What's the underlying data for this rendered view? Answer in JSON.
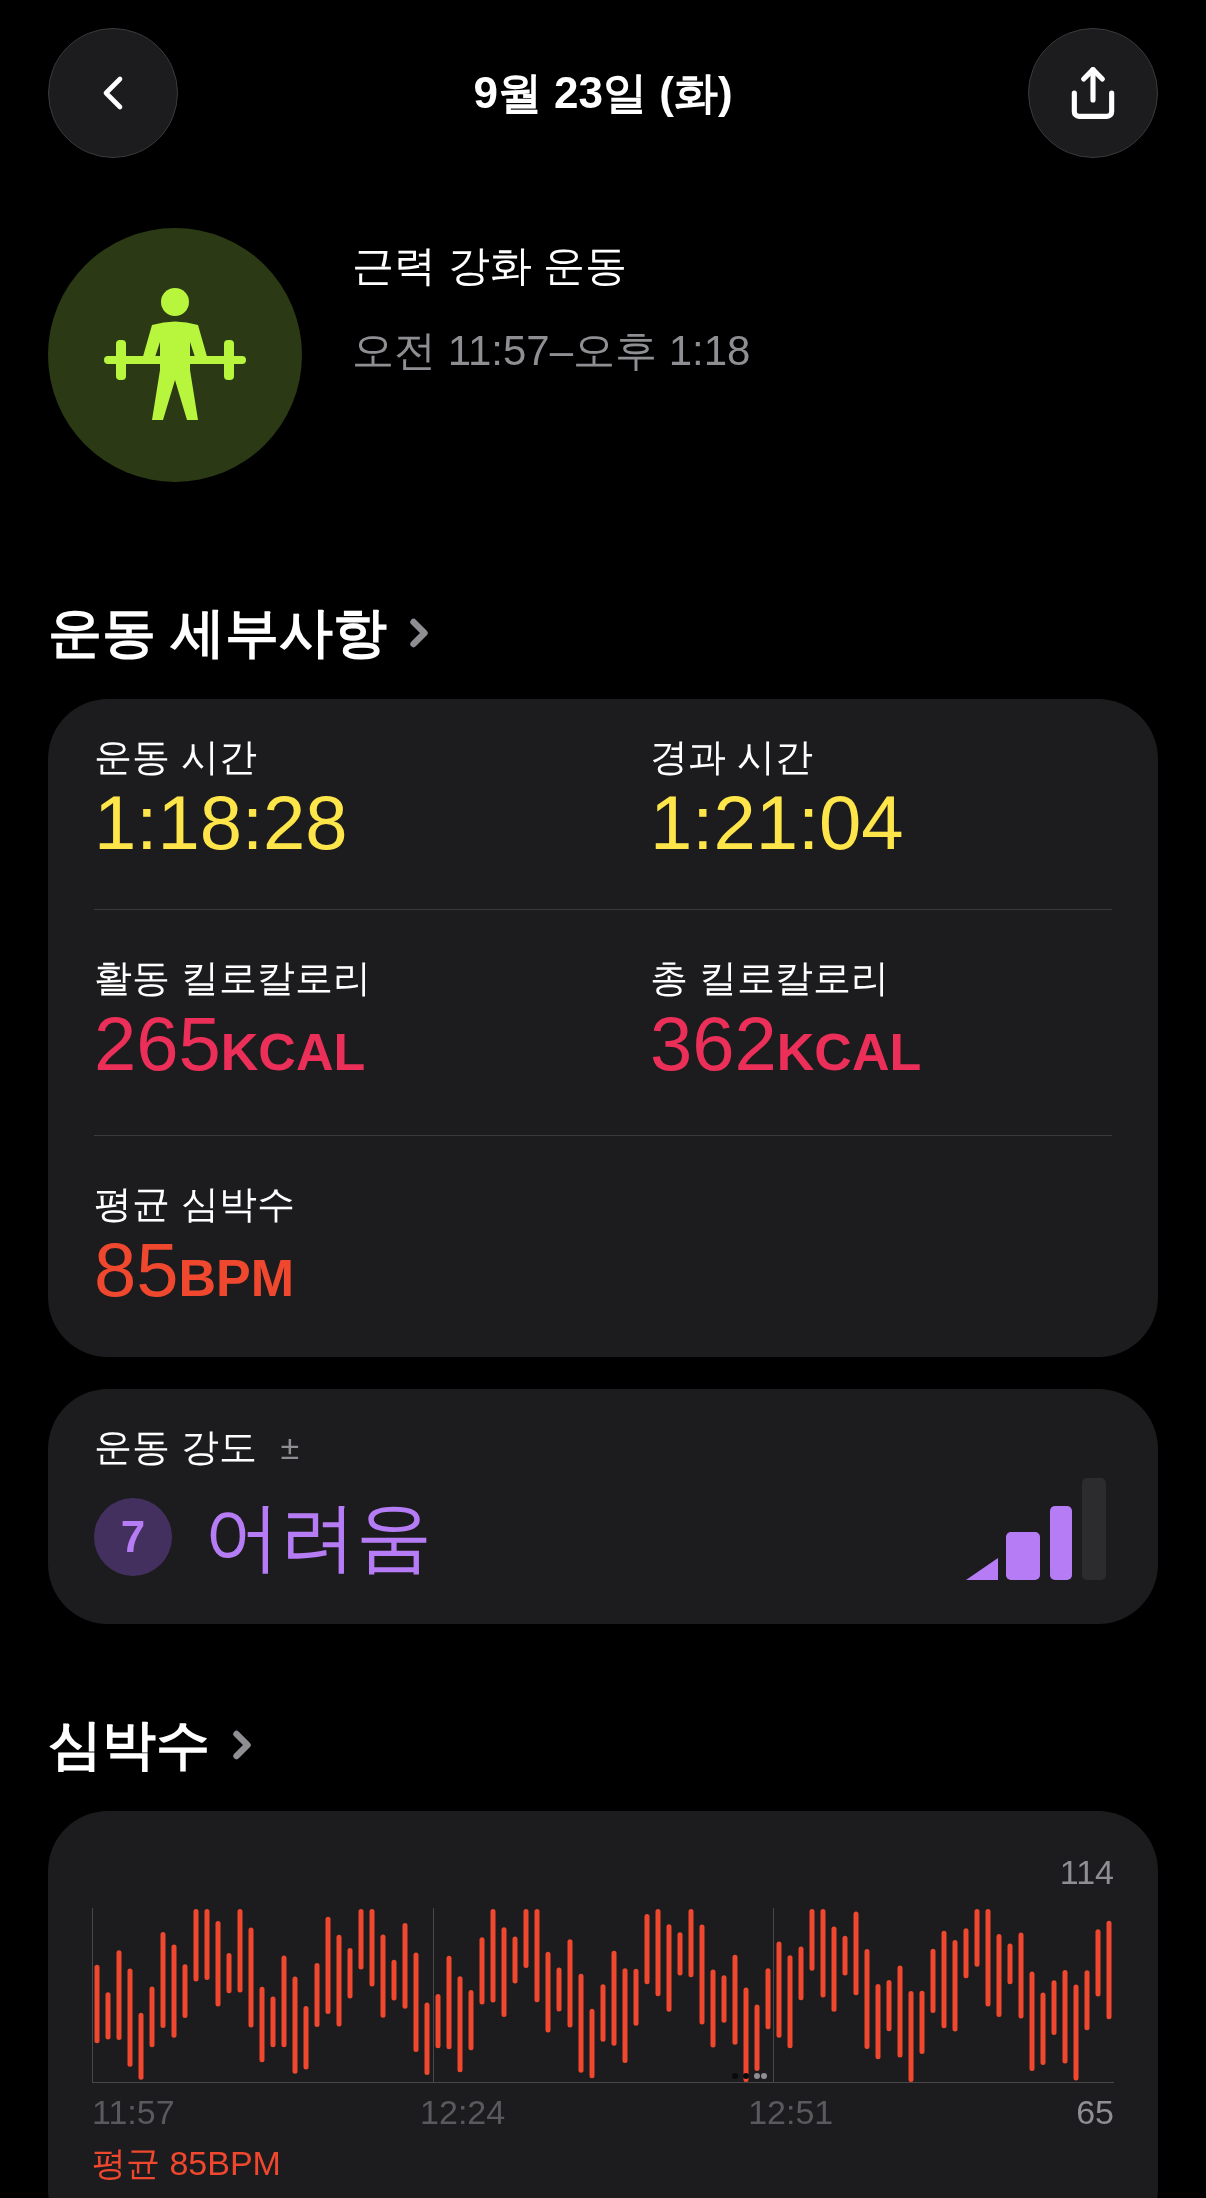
{
  "header": {
    "title": "9월 23일 (화)"
  },
  "workout": {
    "name": "근력 강화 운동",
    "time_range": "오전 11:57–오후 1:18"
  },
  "details": {
    "heading": "운동 세부사항",
    "metrics": [
      {
        "label": "운동 시간",
        "value": "1:18:28",
        "color": "#fde54a"
      },
      {
        "label": "경과 시간",
        "value": "1:21:04",
        "color": "#fde54a"
      },
      {
        "label": "활동 킬로칼로리",
        "value": "265",
        "unit": "KCAL",
        "color": "#ec2f58"
      },
      {
        "label": "총 킬로칼로리",
        "value": "362",
        "unit": "KCAL",
        "color": "#ec2f58"
      },
      {
        "label": "평균 심박수",
        "value": "85",
        "unit": "BPM",
        "color": "#f0482e"
      }
    ]
  },
  "intensity": {
    "label": "운동 강도",
    "adjust": "±",
    "score": "7",
    "rating": "어려움"
  },
  "heart_rate": {
    "heading": "심박수",
    "max": "114",
    "min": "65",
    "times": [
      "11:57",
      "12:24",
      "12:51"
    ],
    "average": "평균 85BPM"
  }
}
